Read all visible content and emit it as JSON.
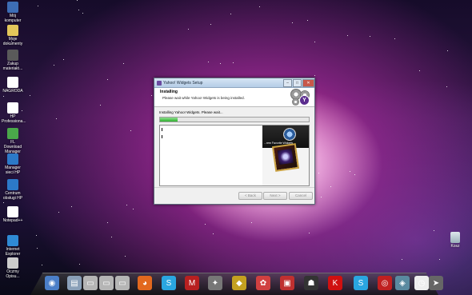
{
  "desktop": {
    "icons": [
      {
        "label": "Mój komputer",
        "icon": "computer-icon",
        "color": "#3d6db5"
      },
      {
        "label": "Moje dokumenty",
        "icon": "documents-icon",
        "color": "#e3c75a"
      },
      {
        "label": "Zakup materiałó...",
        "icon": "folder-icon",
        "color": "#5a5a5a"
      },
      {
        "label": "NAGRODA",
        "icon": "document-icon",
        "color": "#ffffff"
      },
      {
        "label": "HP Professiona...",
        "icon": "hp-icon",
        "color": "#ffffff"
      },
      {
        "label": "FL Download Manager",
        "icon": "download-icon",
        "color": "#4aa84a"
      },
      {
        "label": "Manager sieci HP",
        "icon": "network-icon",
        "color": "#2c79c8"
      },
      {
        "label": "Centrum obsługi HP",
        "icon": "support-icon",
        "color": "#2c79c8"
      },
      {
        "label": "Notepad++",
        "icon": "notepad-icon",
        "color": "#ffffff"
      },
      {
        "label": "Internet Explorer",
        "icon": "ie-icon",
        "color": "#2f8ad4"
      },
      {
        "label": "Oczmy Opisu...",
        "icon": "app-icon",
        "color": "#cccccc"
      }
    ],
    "right_icon": {
      "label": "Kosz",
      "icon": "recycle-bin-icon"
    }
  },
  "dialog": {
    "title": "Yahoo! Widgets Setup",
    "header_title": "Installing",
    "header_subtitle": "Please wait while Yahoo! Widgets is being installed.",
    "status": "Installing Yahoo! Widgets. Please wait...",
    "progress": 0.12,
    "preview_text": "...rem Favorite\nWidgets",
    "buttons": {
      "back": "< Back",
      "next": "Next >",
      "cancel": "Cancel"
    },
    "controls": {
      "minimize": "–",
      "maximize": "□",
      "close": "✕"
    }
  },
  "dock": {
    "items": [
      {
        "name": "windows-icon",
        "color": "#4b7fc8",
        "glyph": "◉"
      },
      {
        "name": "computer-dock-icon",
        "color": "#8aa0b8",
        "glyph": "▤"
      },
      {
        "name": "drive-icon",
        "color": "#b5b5b5",
        "glyph": "▭"
      },
      {
        "name": "drive-icon-2",
        "color": "#b5b5b5",
        "glyph": "▭"
      },
      {
        "name": "drive-icon-3",
        "color": "#b5b5b5",
        "glyph": "▭"
      },
      {
        "name": "firefox-icon",
        "color": "#e2681e",
        "glyph": "◕"
      },
      {
        "name": "skype-icon",
        "color": "#2aa6e0",
        "glyph": "S"
      },
      {
        "name": "media-icon",
        "color": "#b82020",
        "glyph": "M"
      },
      {
        "name": "gamepad-icon",
        "color": "#777777",
        "glyph": "✦"
      },
      {
        "name": "winamp-icon",
        "color": "#c4a020",
        "glyph": "◆"
      },
      {
        "name": "photo-icon",
        "color": "#d04040",
        "glyph": "✿"
      },
      {
        "name": "office-icon",
        "color": "#c03030",
        "glyph": "▣"
      },
      {
        "name": "game-icon",
        "color": "#333333",
        "glyph": "☗"
      },
      {
        "name": "kaspersky-icon",
        "color": "#d01010",
        "glyph": "K"
      },
      {
        "name": "skype-icon-2",
        "color": "#2aa6e0",
        "glyph": "S"
      },
      {
        "name": "radio-icon",
        "color": "#c02020",
        "glyph": "◎"
      },
      {
        "name": "screenshot-icon",
        "color": "#5a8aa0",
        "glyph": "◈"
      },
      {
        "name": "clock-icon",
        "color": "#eeeeee",
        "glyph": "◷"
      },
      {
        "name": "arrow-icon",
        "color": "#666666",
        "glyph": "➤"
      }
    ]
  }
}
